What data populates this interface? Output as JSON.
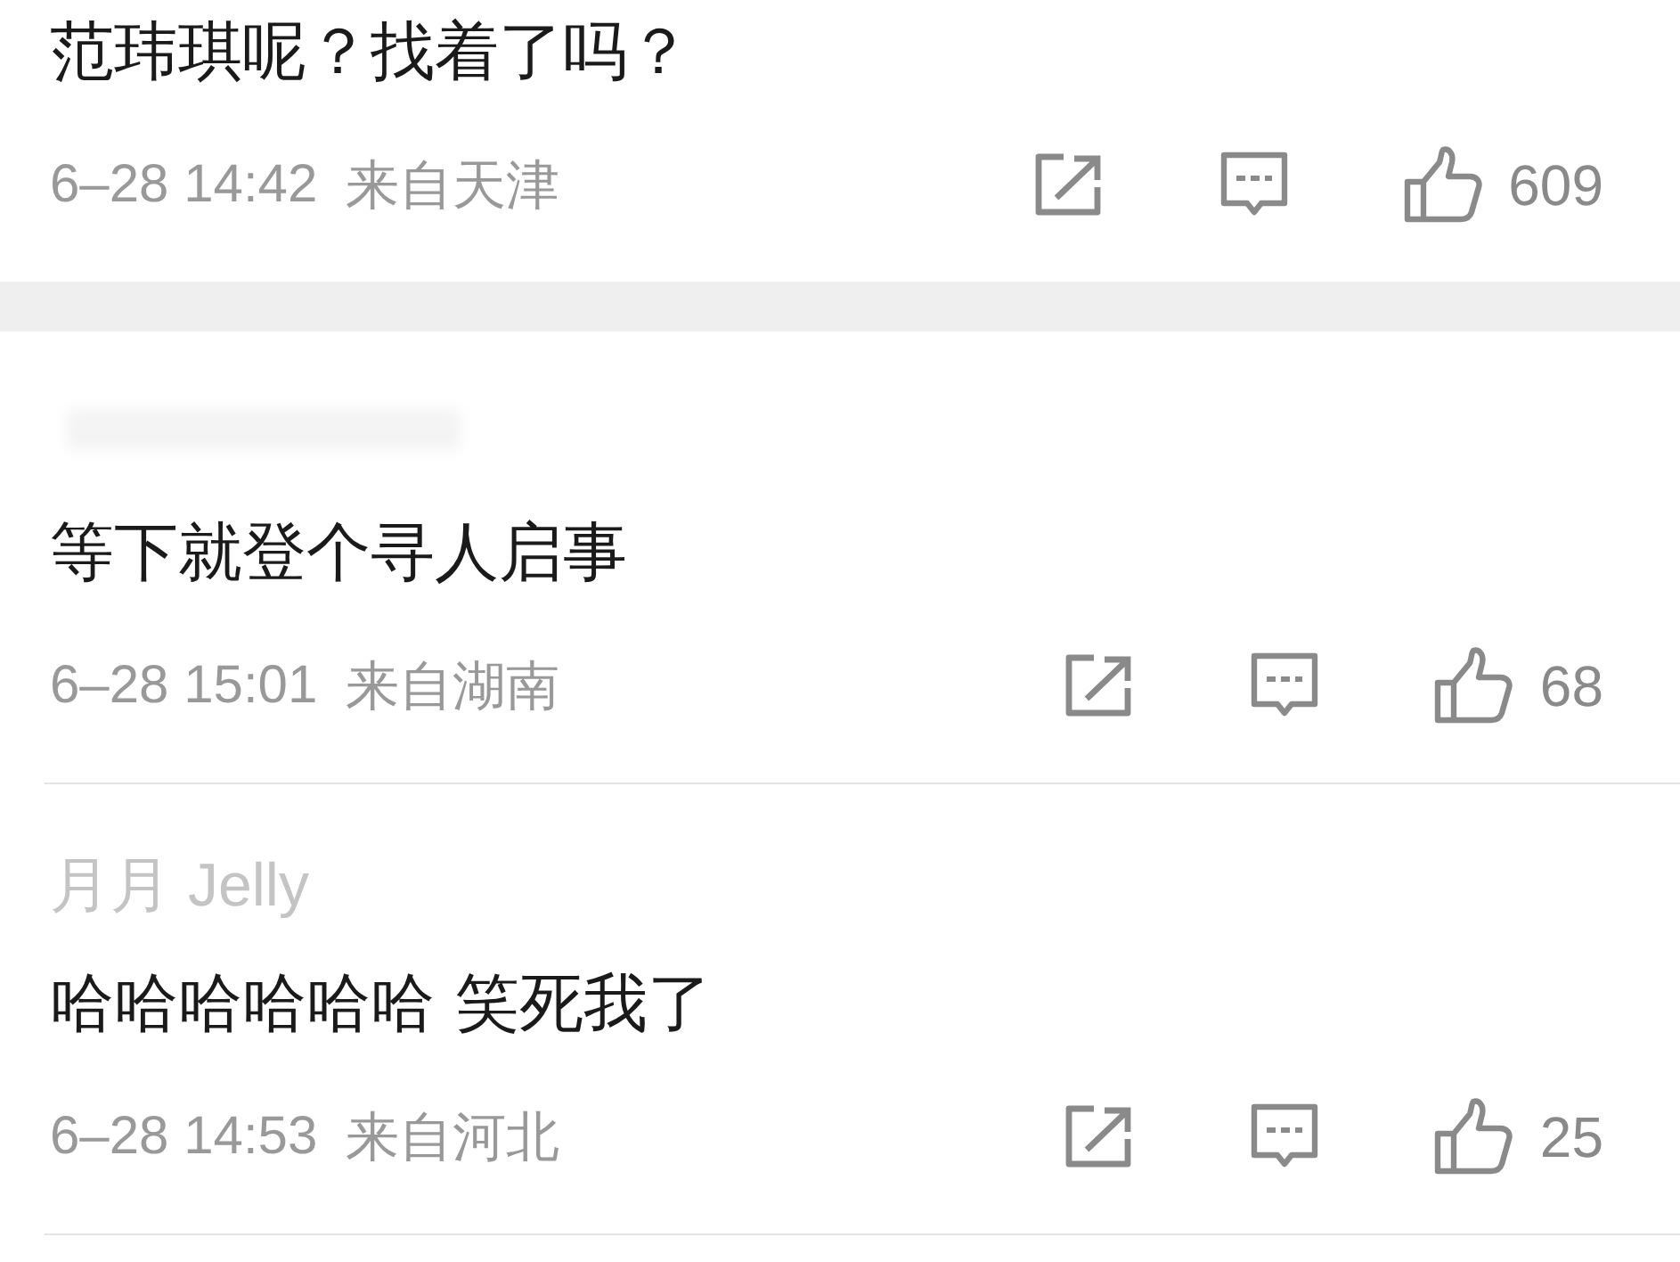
{
  "comments": [
    {
      "username_blurred": false,
      "text": "范玮琪呢？找着了吗？",
      "time": "6–28 14:42",
      "location": "来自天津",
      "likes": "609",
      "section_break_after": true
    },
    {
      "username_blurred": true,
      "text": "等下就登个寻人启事",
      "time": "6–28 15:01",
      "location": "来自湖南",
      "likes": "68",
      "section_break_after": false
    },
    {
      "username": "月月 Jelly",
      "username_blurred": false,
      "text": "哈哈哈哈哈哈 笑死我了",
      "time": "6–28 14:53",
      "location": "来自河北",
      "likes": "25",
      "section_break_after": false
    }
  ]
}
